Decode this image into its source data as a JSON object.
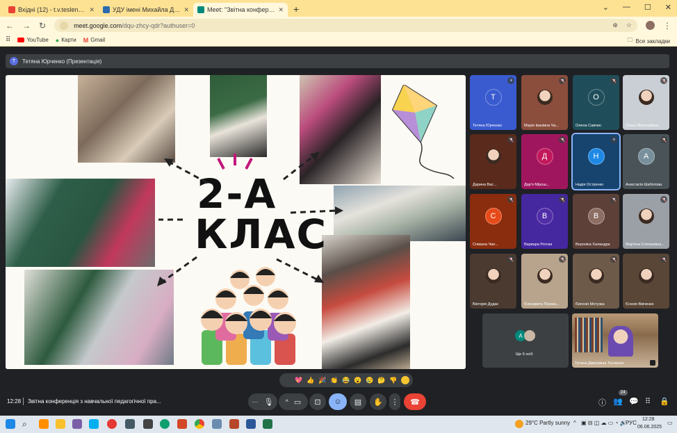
{
  "browser": {
    "tabs": [
      {
        "title": "Вхідні (12) - t.v.teslenko@npu.e",
        "favicon_color": "#ea4335",
        "active": false
      },
      {
        "title": "УДУ імені Михайла Драгоманова",
        "favicon_color": "#2b6cb0",
        "active": false
      },
      {
        "title": "Meet: \"Звітна конференція з\"",
        "favicon_color": "#00897b",
        "active": true
      }
    ],
    "new_tab": "+",
    "url_host": "meet.google.com",
    "url_path": "/dqu-zhcy-qdr?authuser=0",
    "bookmarks": [
      "YouTube",
      "Карти",
      "Gmail"
    ],
    "all_bookmarks": "Все закладки"
  },
  "meet": {
    "presenter_bar": "Тетяна Юрченко (Презентація)",
    "presenter_initial": "T",
    "slide": {
      "line1": "2-А",
      "line2": "КЛАС"
    },
    "participants": [
      {
        "name": "Тетяна Юрченко",
        "initial": "T",
        "bg": "#3a5bd0",
        "avatar_bg": "#3a5bd0",
        "muted": false,
        "photo": false
      },
      {
        "name": "Марія Іванівна Ча...",
        "initial": "",
        "bg": "#8b4e3c",
        "muted": true,
        "photo": true
      },
      {
        "name": "Олена Савчин",
        "initial": "O",
        "bg": "#1f4e5a",
        "avatar_bg": "#1f4e5a",
        "muted": true,
        "photo": false
      },
      {
        "name": "Ольга Миколаївна...",
        "initial": "",
        "bg": "#c9cfd4",
        "muted": true,
        "photo": true
      },
      {
        "name": "Дарина Вас...",
        "initial": "",
        "bg": "#5a2a1c",
        "muted": true,
        "photo": true
      },
      {
        "name": "Дар'я Мірош...",
        "initial": "Д",
        "bg": "#a0165e",
        "avatar_bg": "#c2185b",
        "muted": true,
        "photo": false
      },
      {
        "name": "Надія Остренко",
        "initial": "Н",
        "bg": "#17446e",
        "avatar_bg": "#1e88e5",
        "muted": false,
        "photo": false,
        "active": true
      },
      {
        "name": "Анастасія Шаботова",
        "initial": "А",
        "bg": "#4a5458",
        "avatar_bg": "#78909c",
        "muted": true,
        "photo": false
      },
      {
        "name": "Сніжана Чап...",
        "initial": "С",
        "bg": "#8a2d0e",
        "avatar_bg": "#e64a19",
        "muted": true,
        "photo": false
      },
      {
        "name": "Варвара Рогоза",
        "initial": "В",
        "bg": "#4527a0",
        "avatar_bg": "#512da8",
        "muted": true,
        "photo": false
      },
      {
        "name": "Вероніка Халандра",
        "initial": "В",
        "bg": "#5d4037",
        "avatar_bg": "#8d6e63",
        "muted": true,
        "photo": false
      },
      {
        "name": "Мар'яна Степанівна...",
        "initial": "",
        "bg": "#9aa0a6",
        "muted": true,
        "photo": true
      },
      {
        "name": "Вікторія Дудак",
        "initial": "",
        "bg": "#4a3a30",
        "muted": true,
        "photo": true
      },
      {
        "name": "Єлизавета Позоєк...",
        "initial": "",
        "bg": "#b8a48c",
        "muted": true,
        "photo": true
      },
      {
        "name": "Євгенія Мотузка",
        "initial": "",
        "bg": "#6d5a48",
        "muted": true,
        "photo": true
      },
      {
        "name": "Єсенія Вівченко",
        "initial": "",
        "bg": "#5a4636",
        "muted": true,
        "photo": true
      }
    ],
    "others_label": "Ще 6 осіб",
    "others_initial": "A",
    "self_tile_name": "Тетяна Дмитрівна Тесленко",
    "reactions": [
      "💖",
      "👍",
      "🎉",
      "👏",
      "😂",
      "😮",
      "😢",
      "🤔",
      "👎"
    ],
    "time": "12:28",
    "meeting_title": "Звітна конференція з навчальної педагогічної пра...",
    "people_count": "24",
    "end_call_color": "#ea4335"
  },
  "taskbar": {
    "weather": "29°C  Partly sunny",
    "language": "РУС",
    "clock_time": "12:28",
    "clock_date": "06.06.2025"
  }
}
